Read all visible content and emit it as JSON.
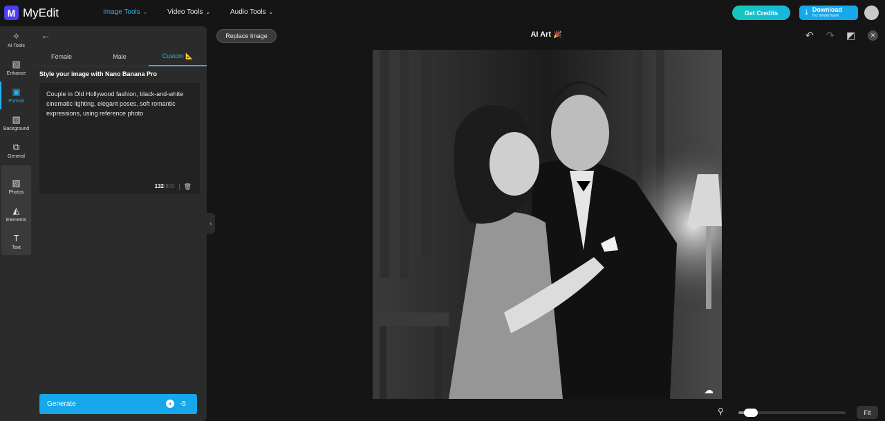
{
  "app": {
    "name": "MyEdit",
    "logo_letter": "M"
  },
  "nav": [
    {
      "label": "Image Tools",
      "active": true
    },
    {
      "label": "Video Tools",
      "active": false
    },
    {
      "label": "Audio Tools",
      "active": false
    }
  ],
  "header": {
    "credits_label": "Get Credits",
    "download_label": "Download",
    "download_sub": "No Watermark"
  },
  "rail": [
    {
      "label": "AI Tools",
      "icon": "magic-wand-icon",
      "glyph": "✧"
    },
    {
      "label": "Enhance",
      "icon": "image-enhance-icon",
      "glyph": "▧"
    },
    {
      "label": "Portrait",
      "icon": "portrait-icon",
      "glyph": "▣",
      "active": true
    },
    {
      "label": "Background",
      "icon": "background-icon",
      "glyph": "▨"
    },
    {
      "label": "General",
      "icon": "general-icon",
      "glyph": "⧉"
    },
    {
      "label": "Photos",
      "icon": "photos-icon",
      "glyph": "▨"
    },
    {
      "label": "Elements",
      "icon": "elements-icon",
      "glyph": "◭"
    },
    {
      "label": "Text",
      "icon": "text-icon",
      "glyph": "T"
    }
  ],
  "panel": {
    "tabs": [
      {
        "label": "Female",
        "active": false
      },
      {
        "label": "Male",
        "active": false
      },
      {
        "label": "Custom 📐",
        "active": true
      }
    ],
    "section_title": "Style your image with Nano Banana Pro",
    "prompt": "Couple in Old Hollywood fashion, black-and-white cinematic lighting, elegant poses, soft romantic expressions, using reference photo",
    "char_count": "132",
    "char_max": "/800",
    "generate_label": "Generate",
    "generate_cost": "-5"
  },
  "canvas": {
    "replace_label": "Replace Image",
    "title": "AI Art",
    "title_emoji": "🎉",
    "fit_label": "Fit",
    "zoom_level": 0.06
  },
  "colors": {
    "accent": "#25b4ee",
    "brand": "#4b3df0",
    "background": "#151515",
    "panel": "#2b2b2b"
  }
}
